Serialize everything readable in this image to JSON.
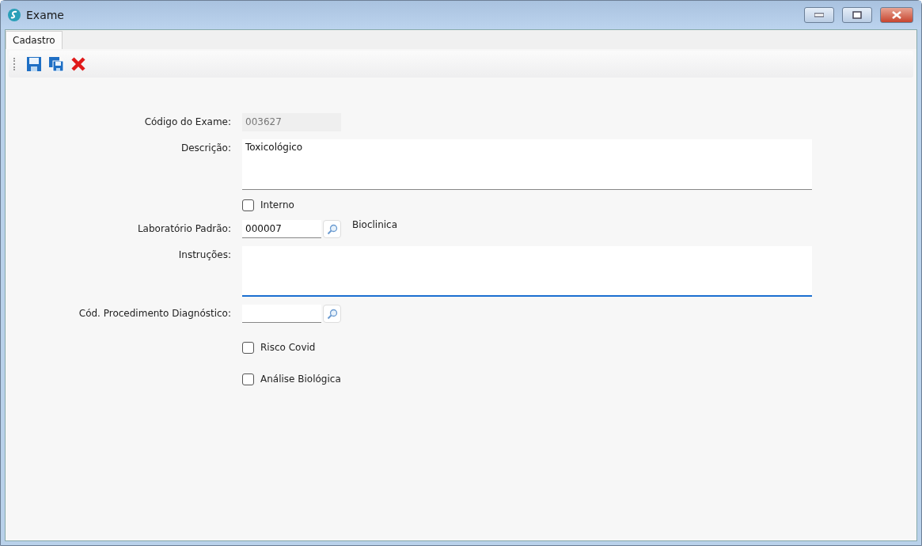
{
  "window": {
    "title": "Exame"
  },
  "tabs": [
    {
      "label": "Cadastro",
      "selected": true
    }
  ],
  "toolbar": [
    {
      "kind": "save"
    },
    {
      "kind": "save_copy"
    },
    {
      "kind": "delete"
    }
  ],
  "fields": [
    {
      "kind": "text",
      "label": "Código do Exame:",
      "value": "003627",
      "disabled": true
    },
    {
      "kind": "textarea",
      "label": "Descrição:",
      "value": "Toxicológico",
      "focused": false
    },
    {
      "kind": "checkbox",
      "label": "Interno",
      "checked": false
    },
    {
      "kind": "lookup",
      "label": "Laboratório Padrão:",
      "value": "000007",
      "lookup_text": "Bioclinica"
    },
    {
      "kind": "textarea",
      "label": "Instruções:",
      "focused": true
    },
    {
      "kind": "lookup",
      "label": "Cód. Procedimento Diagnóstico:"
    },
    {
      "kind": "checkbox",
      "label": "Risco Covid",
      "checked": false
    },
    {
      "kind": "checkbox",
      "label": "Análise Biológica",
      "checked": false
    }
  ]
}
